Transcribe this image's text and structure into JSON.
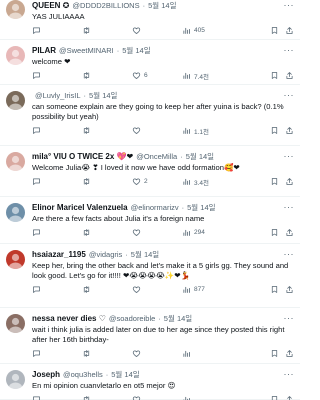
{
  "tweets": [
    {
      "name": "QUEEN ✪",
      "handle": "@DDDD2BILLIONS",
      "date": "5월 14일",
      "text": "YAS JULIAAAA",
      "replies": "",
      "retweets": "",
      "likes": "",
      "views": "405",
      "avatar_color": "#c9a891"
    },
    {
      "name": "PILAR",
      "handle": "@SweetMINARI",
      "date": "5월 14일",
      "text": "welcome ❤",
      "replies": "",
      "retweets": "",
      "likes": "6",
      "views": "7.4천",
      "avatar_color": "#e8b8b8"
    },
    {
      "name": "",
      "handle": "@Luvly_IrisIL",
      "date": "5월 14일",
      "text": "can someone explain are they going to keep her after yuina is back? (0.1% possibility but yeah)",
      "replies": "",
      "retweets": "",
      "likes": "",
      "views": "1.1천",
      "avatar_color": "#7a6a5a"
    },
    {
      "name": "mila° VIU O TWICE 2x 💖❤",
      "handle": "@OnceMilla",
      "date": "5월 14일",
      "text": "Welcome Julia😭 ❣ I loved it now we have odd formation🥰❤",
      "replies": "",
      "retweets": "",
      "likes": "2",
      "views": "3.4천",
      "avatar_color": "#d9a9a0"
    },
    {
      "name": "Elinor Maricel Valenzuela",
      "handle": "@elinormarizv",
      "date": "5월 14일",
      "text": "Are there a few facts about Julia it's a foreign name",
      "replies": "",
      "retweets": "",
      "likes": "",
      "views": "294",
      "avatar_color": "#6e8fa8"
    },
    {
      "name": "hsaiazar_1195",
      "handle": "@vidagris",
      "date": "5월 14일",
      "text": "Keep her, bring the other back and let's make it a 5 girls gg. They sound and look good. Let's go for it!!!! ❤😭😭😭😭✨❤💃",
      "replies": "",
      "retweets": "",
      "likes": "",
      "views": "877",
      "avatar_color": "#c0392b"
    },
    {
      "name": "nessa never dies ♡",
      "handle": "@soadoreible",
      "date": "5월 14일",
      "text": "wait i think julia is added later on due to her age since they posted this right after her 16th birthday-",
      "replies": "",
      "retweets": "",
      "likes": "",
      "views": "",
      "avatar_color": "#8a6e64"
    },
    {
      "name": "Joseph",
      "handle": "@oqu3hells",
      "date": "5월 14일",
      "text": "En mi opinion cuanvletarlo en ot5 mejor 😍",
      "replies": "",
      "retweets": "",
      "likes": "",
      "views": "",
      "avatar_color": "#b0b6bd"
    }
  ],
  "icons": {
    "reply": "reply-icon",
    "retweet": "retweet-icon",
    "like": "heart-icon",
    "views": "views-icon",
    "more": "more-icon"
  },
  "colors": {
    "text": "#0f1419",
    "secondary": "#536471",
    "divider": "#eff3f4",
    "verified": "#1d9bf0"
  }
}
